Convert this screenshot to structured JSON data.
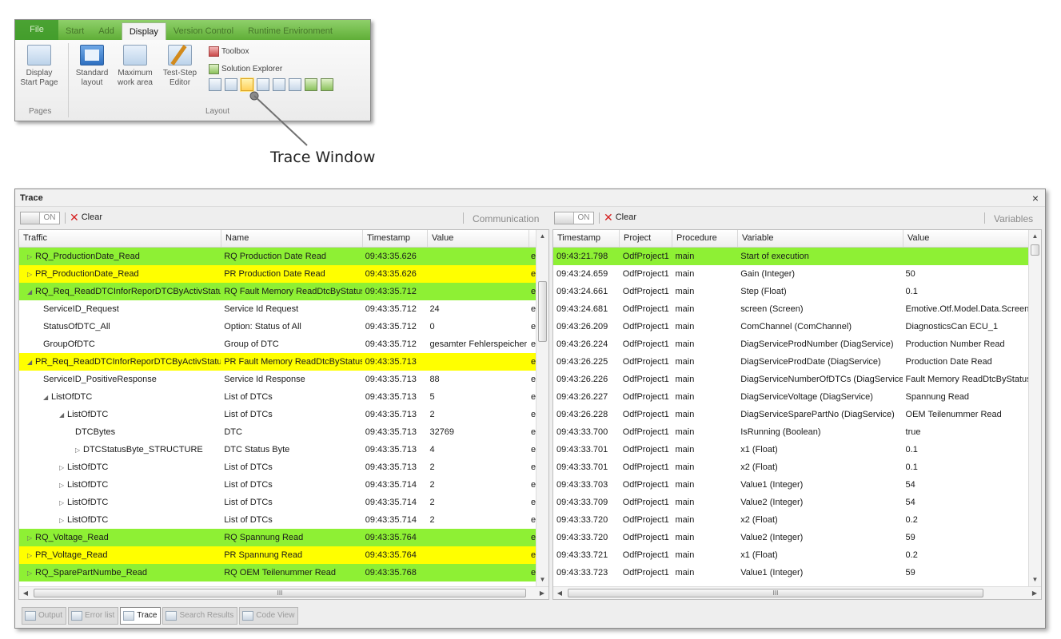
{
  "ribbon": {
    "tabs": [
      "File",
      "Start",
      "Add",
      "Display",
      "Version Control",
      "Runtime Environment"
    ],
    "active_tab": "Display",
    "pages_group": {
      "label": "Pages",
      "display_start_page": "Display Start Page"
    },
    "layout_group": {
      "label": "Layout",
      "standard_layout": "Standard layout",
      "maximum_work_area": "Maximum work area",
      "test_step_editor": "Test-Step Editor",
      "toolbox": "Toolbox",
      "solution_explorer": "Solution Explorer"
    }
  },
  "callout": {
    "label": "Trace Window"
  },
  "trace": {
    "title": "Trace",
    "close_glyph": "×",
    "communication": {
      "toggle_label": "ON",
      "clear_label": "Clear",
      "section_label": "Communication",
      "columns": [
        "Traffic",
        "Name",
        "Timestamp",
        "Value"
      ],
      "rows": [
        {
          "hl": "green",
          "lvl": 0,
          "exp": "▷",
          "traffic": "RQ_ProductionDate_Read",
          "name": "RQ Production Date Read",
          "ts": "09:43:35.626",
          "value": "",
          "tail": "e"
        },
        {
          "hl": "yellow",
          "lvl": 0,
          "exp": "▷",
          "traffic": "PR_ProductionDate_Read",
          "name": "PR Production Date Read",
          "ts": "09:43:35.626",
          "value": "",
          "tail": "e"
        },
        {
          "hl": "green",
          "lvl": 0,
          "exp": "◢",
          "traffic": "RQ_Req_ReadDTCInforReporDTCByActivStatus",
          "name": "RQ Fault Memory ReadDtcByStatus",
          "ts": "09:43:35.712",
          "value": "",
          "tail": "e"
        },
        {
          "hl": "",
          "lvl": 1,
          "exp": "",
          "traffic": "ServiceID_Request",
          "name": "Service Id Request",
          "ts": "09:43:35.712",
          "value": "24",
          "tail": "e"
        },
        {
          "hl": "",
          "lvl": 1,
          "exp": "",
          "traffic": "StatusOfDTC_All",
          "name": "Option: Status of All",
          "ts": "09:43:35.712",
          "value": "0",
          "tail": "e"
        },
        {
          "hl": "",
          "lvl": 1,
          "exp": "",
          "traffic": "GroupOfDTC",
          "name": "Group of DTC",
          "ts": "09:43:35.712",
          "value": "gesamter Fehlerspeicher",
          "tail": "e"
        },
        {
          "hl": "yellow",
          "lvl": 0,
          "exp": "◢",
          "traffic": "PR_Req_ReadDTCInforReporDTCByActivStatus",
          "name": "PR Fault Memory ReadDtcByStatus",
          "ts": "09:43:35.713",
          "value": "",
          "tail": "e"
        },
        {
          "hl": "",
          "lvl": 1,
          "exp": "",
          "traffic": "ServiceID_PositiveResponse",
          "name": "Service Id Response",
          "ts": "09:43:35.713",
          "value": "88",
          "tail": "e"
        },
        {
          "hl": "",
          "lvl": 1,
          "exp": "◢",
          "traffic": "ListOfDTC",
          "name": "List of DTCs",
          "ts": "09:43:35.713",
          "value": "5",
          "tail": "e"
        },
        {
          "hl": "",
          "lvl": 2,
          "exp": "◢",
          "traffic": "ListOfDTC",
          "name": "List of DTCs",
          "ts": "09:43:35.713",
          "value": "2",
          "tail": "e"
        },
        {
          "hl": "",
          "lvl": 3,
          "exp": "",
          "traffic": "DTCBytes",
          "name": "DTC",
          "ts": "09:43:35.713",
          "value": "32769",
          "tail": "e"
        },
        {
          "hl": "",
          "lvl": 3,
          "exp": "▷",
          "traffic": "DTCStatusByte_STRUCTURE",
          "name": "DTC Status Byte",
          "ts": "09:43:35.713",
          "value": "4",
          "tail": "e"
        },
        {
          "hl": "",
          "lvl": 2,
          "exp": "▷",
          "traffic": "ListOfDTC",
          "name": "List of DTCs",
          "ts": "09:43:35.713",
          "value": "2",
          "tail": "e"
        },
        {
          "hl": "",
          "lvl": 2,
          "exp": "▷",
          "traffic": "ListOfDTC",
          "name": "List of DTCs",
          "ts": "09:43:35.714",
          "value": "2",
          "tail": "e"
        },
        {
          "hl": "",
          "lvl": 2,
          "exp": "▷",
          "traffic": "ListOfDTC",
          "name": "List of DTCs",
          "ts": "09:43:35.714",
          "value": "2",
          "tail": "e"
        },
        {
          "hl": "",
          "lvl": 2,
          "exp": "▷",
          "traffic": "ListOfDTC",
          "name": "List of DTCs",
          "ts": "09:43:35.714",
          "value": "2",
          "tail": "e"
        },
        {
          "hl": "green",
          "lvl": 0,
          "exp": "▷",
          "traffic": "RQ_Voltage_Read",
          "name": "RQ Spannung Read",
          "ts": "09:43:35.764",
          "value": "",
          "tail": "e"
        },
        {
          "hl": "yellow",
          "lvl": 0,
          "exp": "▷",
          "traffic": "PR_Voltage_Read",
          "name": "PR Spannung Read",
          "ts": "09:43:35.764",
          "value": "",
          "tail": "e"
        },
        {
          "hl": "green",
          "lvl": 0,
          "exp": "▷",
          "traffic": "RQ_SparePartNumbe_Read",
          "name": "RQ OEM Teilenummer Read",
          "ts": "09:43:35.768",
          "value": "",
          "tail": "e"
        }
      ]
    },
    "variables": {
      "toggle_label": "ON",
      "clear_label": "Clear",
      "section_label": "Variables",
      "columns": [
        "Timestamp",
        "Project",
        "Procedure",
        "Variable",
        "Value"
      ],
      "rows": [
        {
          "hl": "green",
          "ts": "09:43:21.798",
          "project": "OdfProject1",
          "proc": "main",
          "variable": "Start of execution",
          "value": ""
        },
        {
          "hl": "",
          "ts": "09:43:24.659",
          "project": "OdfProject1",
          "proc": "main",
          "variable": "Gain  (Integer)",
          "value": "50"
        },
        {
          "hl": "",
          "ts": "09:43:24.661",
          "project": "OdfProject1",
          "proc": "main",
          "variable": "Step  (Float)",
          "value": "0.1"
        },
        {
          "hl": "",
          "ts": "09:43:24.681",
          "project": "OdfProject1",
          "proc": "main",
          "variable": "screen  (Screen)",
          "value": "Emotive.Otf.Model.Data.Screen"
        },
        {
          "hl": "",
          "ts": "09:43:26.209",
          "project": "OdfProject1",
          "proc": "main",
          "variable": "ComChannel  (ComChannel)",
          "value": "DiagnosticsCan ECU_1"
        },
        {
          "hl": "",
          "ts": "09:43:26.224",
          "project": "OdfProject1",
          "proc": "main",
          "variable": "DiagServiceProdNumber  (DiagService)",
          "value": "Production Number Read"
        },
        {
          "hl": "",
          "ts": "09:43:26.225",
          "project": "OdfProject1",
          "proc": "main",
          "variable": "DiagServiceProdDate  (DiagService)",
          "value": "Production Date Read"
        },
        {
          "hl": "",
          "ts": "09:43:26.226",
          "project": "OdfProject1",
          "proc": "main",
          "variable": "DiagServiceNumberOfDTCs  (DiagService)",
          "value": "Fault Memory ReadDtcByStatus"
        },
        {
          "hl": "",
          "ts": "09:43:26.227",
          "project": "OdfProject1",
          "proc": "main",
          "variable": "DiagServiceVoltage  (DiagService)",
          "value": "Spannung Read"
        },
        {
          "hl": "",
          "ts": "09:43:26.228",
          "project": "OdfProject1",
          "proc": "main",
          "variable": "DiagServiceSparePartNo  (DiagService)",
          "value": "OEM Teilenummer Read"
        },
        {
          "hl": "",
          "ts": "09:43:33.700",
          "project": "OdfProject1",
          "proc": "main",
          "variable": "IsRunning  (Boolean)",
          "value": "true"
        },
        {
          "hl": "",
          "ts": "09:43:33.701",
          "project": "OdfProject1",
          "proc": "main",
          "variable": "x1  (Float)",
          "value": "0.1"
        },
        {
          "hl": "",
          "ts": "09:43:33.701",
          "project": "OdfProject1",
          "proc": "main",
          "variable": "x2  (Float)",
          "value": "0.1"
        },
        {
          "hl": "",
          "ts": "09:43:33.703",
          "project": "OdfProject1",
          "proc": "main",
          "variable": "Value1  (Integer)",
          "value": "54"
        },
        {
          "hl": "",
          "ts": "09:43:33.709",
          "project": "OdfProject1",
          "proc": "main",
          "variable": "Value2  (Integer)",
          "value": "54"
        },
        {
          "hl": "",
          "ts": "09:43:33.720",
          "project": "OdfProject1",
          "proc": "main",
          "variable": "x2  (Float)",
          "value": "0.2"
        },
        {
          "hl": "",
          "ts": "09:43:33.720",
          "project": "OdfProject1",
          "proc": "main",
          "variable": "Value2  (Integer)",
          "value": "59"
        },
        {
          "hl": "",
          "ts": "09:43:33.721",
          "project": "OdfProject1",
          "proc": "main",
          "variable": "x1  (Float)",
          "value": "0.2"
        },
        {
          "hl": "",
          "ts": "09:43:33.723",
          "project": "OdfProject1",
          "proc": "main",
          "variable": "Value1  (Integer)",
          "value": "59"
        }
      ]
    },
    "bottom_tabs": [
      "Output",
      "Error list",
      "Trace",
      "Search Results",
      "Code View"
    ],
    "active_bottom_tab": "Trace",
    "hscroll_grip": "III"
  },
  "colors": {
    "request_row": "#8ef034",
    "response_row": "#ffff00",
    "ribbon_green": "#5fae37"
  }
}
